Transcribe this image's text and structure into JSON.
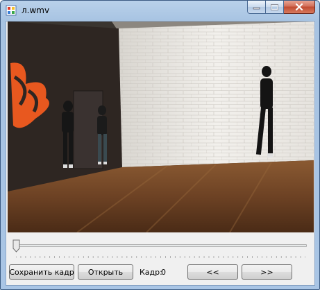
{
  "window": {
    "title": "л.wmv",
    "icon": "app-window-icon",
    "controls": [
      "minimize-icon",
      "maximize-icon",
      "close-icon"
    ]
  },
  "video": {
    "description_icon": "video-frame"
  },
  "trackbar": {
    "value": 0
  },
  "buttons": {
    "save_frame": "Сохранить кадр",
    "open": "Открыть",
    "prev": "<<",
    "next": ">>"
  },
  "frame": {
    "label": "Кадр:",
    "value": "0"
  },
  "colors": {
    "titlebar": "#a9c5e5",
    "close_button": "#c14a30",
    "client_bg": "#f0f0f0"
  }
}
